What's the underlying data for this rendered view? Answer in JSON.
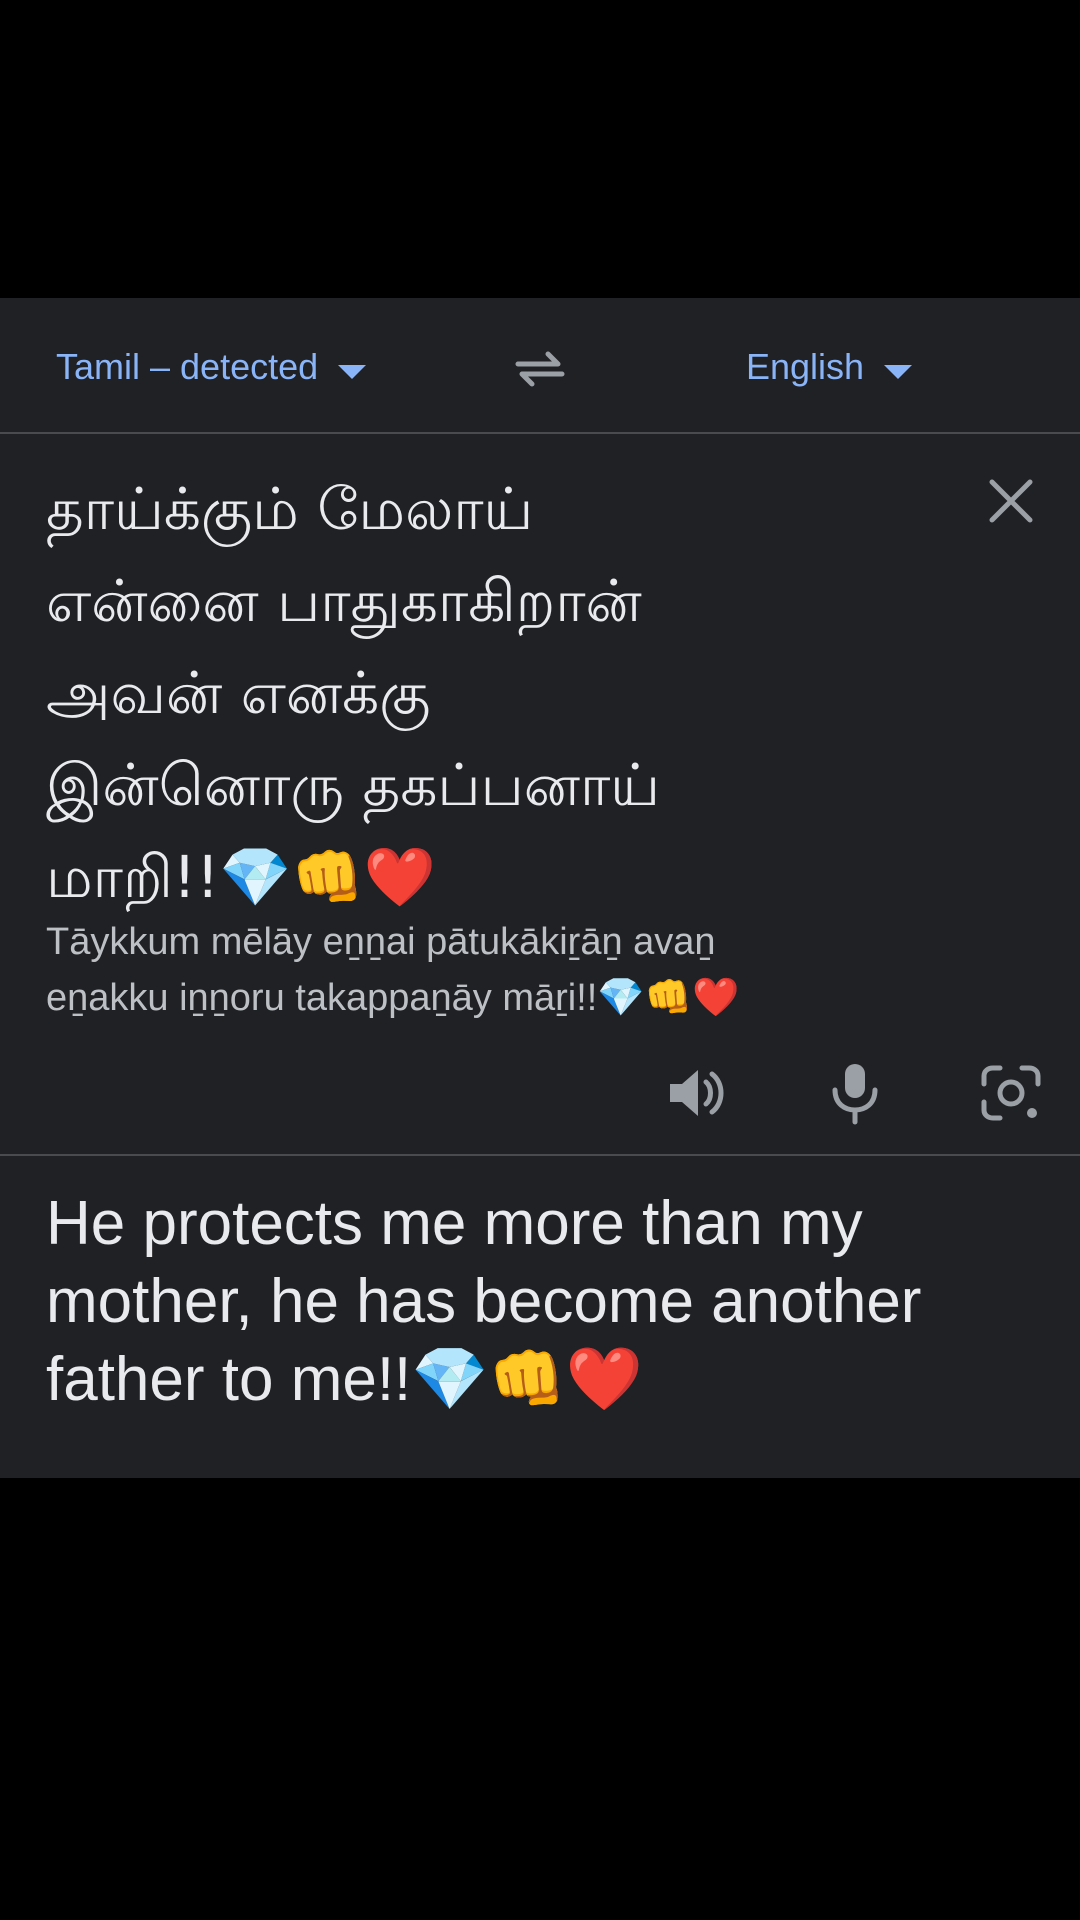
{
  "lang_bar": {
    "source_language": "Tamil – detected",
    "target_language": "English"
  },
  "source": {
    "text": "தாய்க்கும் மேலாய்\nஎன்னை பாதுகாகிறான்\nஅவன் எனக்கு\nஇன்னொரு தகப்பனாய்\nமாறி!!💎👊❤️",
    "transliteration": "Tāykkum mēlāy eṉṉai pātukākiṟāṉ avaṉ\neṉakku iṉṉoru takappaṉāy māṟi!!💎👊❤️"
  },
  "translation": {
    "text": "He protects me more than my\nmother, he has become another\nfather to me!!💎👊❤️"
  },
  "icons": {
    "swap": "swap-languages-icon",
    "clear": "close-icon",
    "speaker": "speaker-icon",
    "mic": "microphone-icon",
    "lens": "camera-lens-icon"
  },
  "colors": {
    "accent": "#8ab4f8",
    "panel_background": "#202124",
    "page_background": "#000000",
    "icon_gray": "#9aa0a6"
  }
}
